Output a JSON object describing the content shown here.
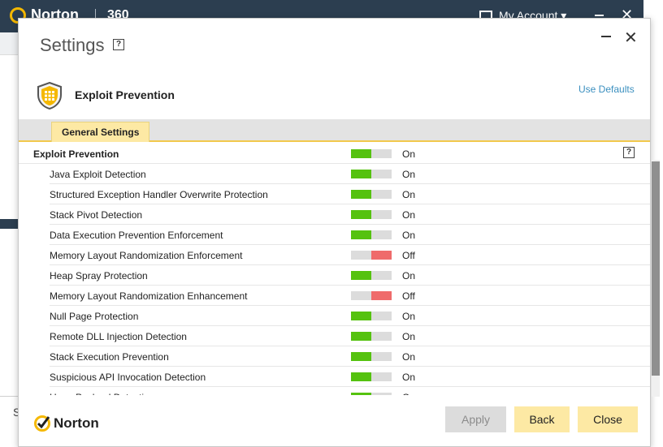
{
  "background": {
    "brand": "Norton",
    "product": "360",
    "account_label": "My Account ▾",
    "close_glyph": "✕",
    "side_text": "S"
  },
  "dialog": {
    "title": "Settings",
    "help_glyph": "?",
    "minimize_glyph": "",
    "close_glyph": "✕",
    "section_title": "Exploit Prevention",
    "use_defaults": "Use Defaults",
    "tab": "General Settings",
    "footer_brand": "Norton",
    "buttons": {
      "apply": "Apply",
      "back": "Back",
      "close": "Close"
    }
  },
  "colors": {
    "on": "#55c20f",
    "off": "#ef6b6b",
    "accent": "#fde9a4",
    "link": "#3a8fbf"
  },
  "settings": [
    {
      "label": "Exploit Prevention",
      "state": "On",
      "on": true,
      "header": true
    },
    {
      "label": "Java Exploit Detection",
      "state": "On",
      "on": true
    },
    {
      "label": "Structured Exception Handler Overwrite Protection",
      "state": "On",
      "on": true
    },
    {
      "label": "Stack Pivot Detection",
      "state": "On",
      "on": true
    },
    {
      "label": "Data Execution Prevention Enforcement",
      "state": "On",
      "on": true
    },
    {
      "label": "Memory Layout Randomization Enforcement",
      "state": "Off",
      "on": false
    },
    {
      "label": "Heap Spray Protection",
      "state": "On",
      "on": true
    },
    {
      "label": "Memory Layout Randomization Enhancement",
      "state": "Off",
      "on": false
    },
    {
      "label": "Null Page Protection",
      "state": "On",
      "on": true
    },
    {
      "label": "Remote DLL Injection Detection",
      "state": "On",
      "on": true
    },
    {
      "label": "Stack Execution Prevention",
      "state": "On",
      "on": true
    },
    {
      "label": "Suspicious API Invocation Detection",
      "state": "On",
      "on": true
    },
    {
      "label": "Heap Payload Detection",
      "state": "On",
      "on": true
    }
  ]
}
